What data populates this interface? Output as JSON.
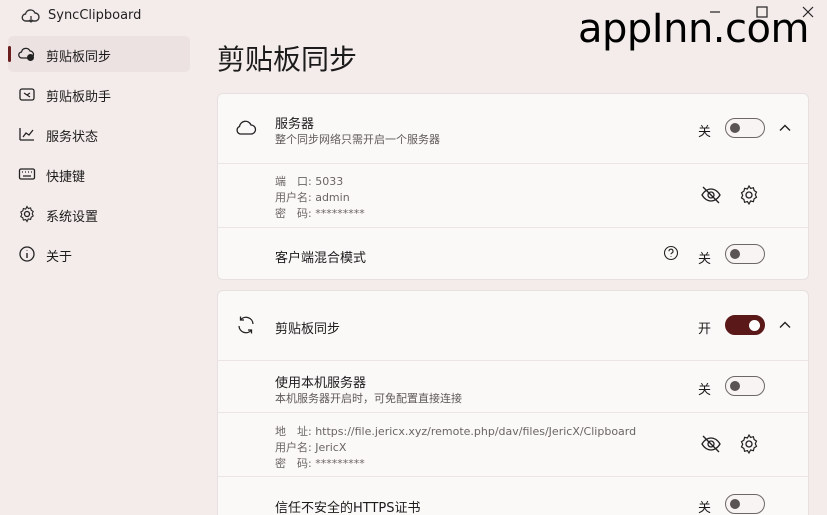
{
  "app": {
    "title": "SyncClipboard",
    "watermark": "appInn.com"
  },
  "sidebar": {
    "items": [
      {
        "label": "剪贴板同步",
        "icon": "cloud-sync-icon",
        "active": true
      },
      {
        "label": "剪贴板助手",
        "icon": "clipboard-assistant-icon",
        "active": false
      },
      {
        "label": "服务状态",
        "icon": "chart-icon",
        "active": false
      },
      {
        "label": "快捷键",
        "icon": "keyboard-icon",
        "active": false
      },
      {
        "label": "系统设置",
        "icon": "gear-icon",
        "active": false
      },
      {
        "label": "关于",
        "icon": "info-icon",
        "active": false
      }
    ]
  },
  "page": {
    "title": "剪贴板同步"
  },
  "server_card": {
    "title": "服务器",
    "subtitle": "整个同步网络只需开启一个服务器",
    "state": "关",
    "enabled": false,
    "info": {
      "port": "端　口: 5033",
      "user": "用户名: admin",
      "password": "密　码: *********"
    },
    "mixed_mode": {
      "title": "客户端混合模式",
      "state": "关",
      "enabled": false
    }
  },
  "sync_card": {
    "title": "剪贴板同步",
    "state": "开",
    "enabled": true,
    "local_server": {
      "title": "使用本机服务器",
      "subtitle": "本机服务器开启时，可免配置直接连接",
      "state": "关",
      "enabled": false
    },
    "info": {
      "address": "地　址: https://file.jericx.xyz/remote.php/dav/files/JericX/Clipboard",
      "user": "用户名: JericX",
      "password": "密　码: *********"
    },
    "https": {
      "title": "信任不安全的HTTPS证书",
      "state": "关",
      "enabled": false
    }
  },
  "colors": {
    "accent": "#5a1818",
    "background": "#f4eceb",
    "card": "#fbf9f8"
  }
}
